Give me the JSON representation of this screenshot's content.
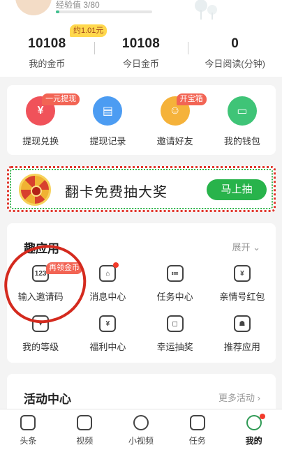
{
  "header": {
    "exp_label": "经验值 3/80",
    "exp_progress": 0.0375,
    "coin_badge": "约1.01元",
    "stats": [
      {
        "value": "10108",
        "label": "我的金币"
      },
      {
        "value": "10108",
        "label": "今日金币"
      },
      {
        "value": "0",
        "label": "今日阅读(分钟)"
      }
    ]
  },
  "quick_actions": [
    {
      "label": "提现兑换",
      "icon": "yen-icon",
      "glyph": "¥",
      "color": "#f0525a",
      "badge": "一元提现"
    },
    {
      "label": "提现记录",
      "icon": "record-icon",
      "glyph": "▤",
      "color": "#4c9cf2",
      "badge": ""
    },
    {
      "label": "邀请好友",
      "icon": "friend-icon",
      "glyph": "☺",
      "color": "#f5b23a",
      "badge": "开宝箱"
    },
    {
      "label": "我的钱包",
      "icon": "wallet-icon",
      "glyph": "▭",
      "color": "#3fc477",
      "badge": ""
    }
  ],
  "banner": {
    "title": "翻卡免费抽大奖",
    "button": "马上抽"
  },
  "apps": {
    "title": "趣应用",
    "expand": "展开 ⌄",
    "items": [
      {
        "label": "输入邀请码",
        "icon": "invite-code-icon",
        "glyph": "123",
        "badge": "再领金币"
      },
      {
        "label": "消息中心",
        "icon": "message-icon",
        "glyph": "⌂",
        "dot": true
      },
      {
        "label": "任务中心",
        "icon": "task-icon",
        "glyph": "≔"
      },
      {
        "label": "亲情号红包",
        "icon": "family-redpacket-icon",
        "glyph": "¥"
      },
      {
        "label": "我的等级",
        "icon": "level-icon",
        "glyph": "▾"
      },
      {
        "label": "福利中心",
        "icon": "welfare-icon",
        "glyph": "¥"
      },
      {
        "label": "幸运抽奖",
        "icon": "lottery-icon",
        "glyph": "◻"
      },
      {
        "label": "推荐应用",
        "icon": "recommend-app-icon",
        "glyph": "☗"
      }
    ]
  },
  "activity": {
    "title": "活动中心",
    "more": "更多活动 ›"
  },
  "tabbar": [
    {
      "label": "头条",
      "icon": "headline-icon"
    },
    {
      "label": "视频",
      "icon": "video-icon"
    },
    {
      "label": "小视频",
      "icon": "short-video-icon"
    },
    {
      "label": "任务",
      "icon": "task-tab-icon"
    },
    {
      "label": "我的",
      "icon": "profile-icon",
      "active": true,
      "dot": true
    }
  ]
}
